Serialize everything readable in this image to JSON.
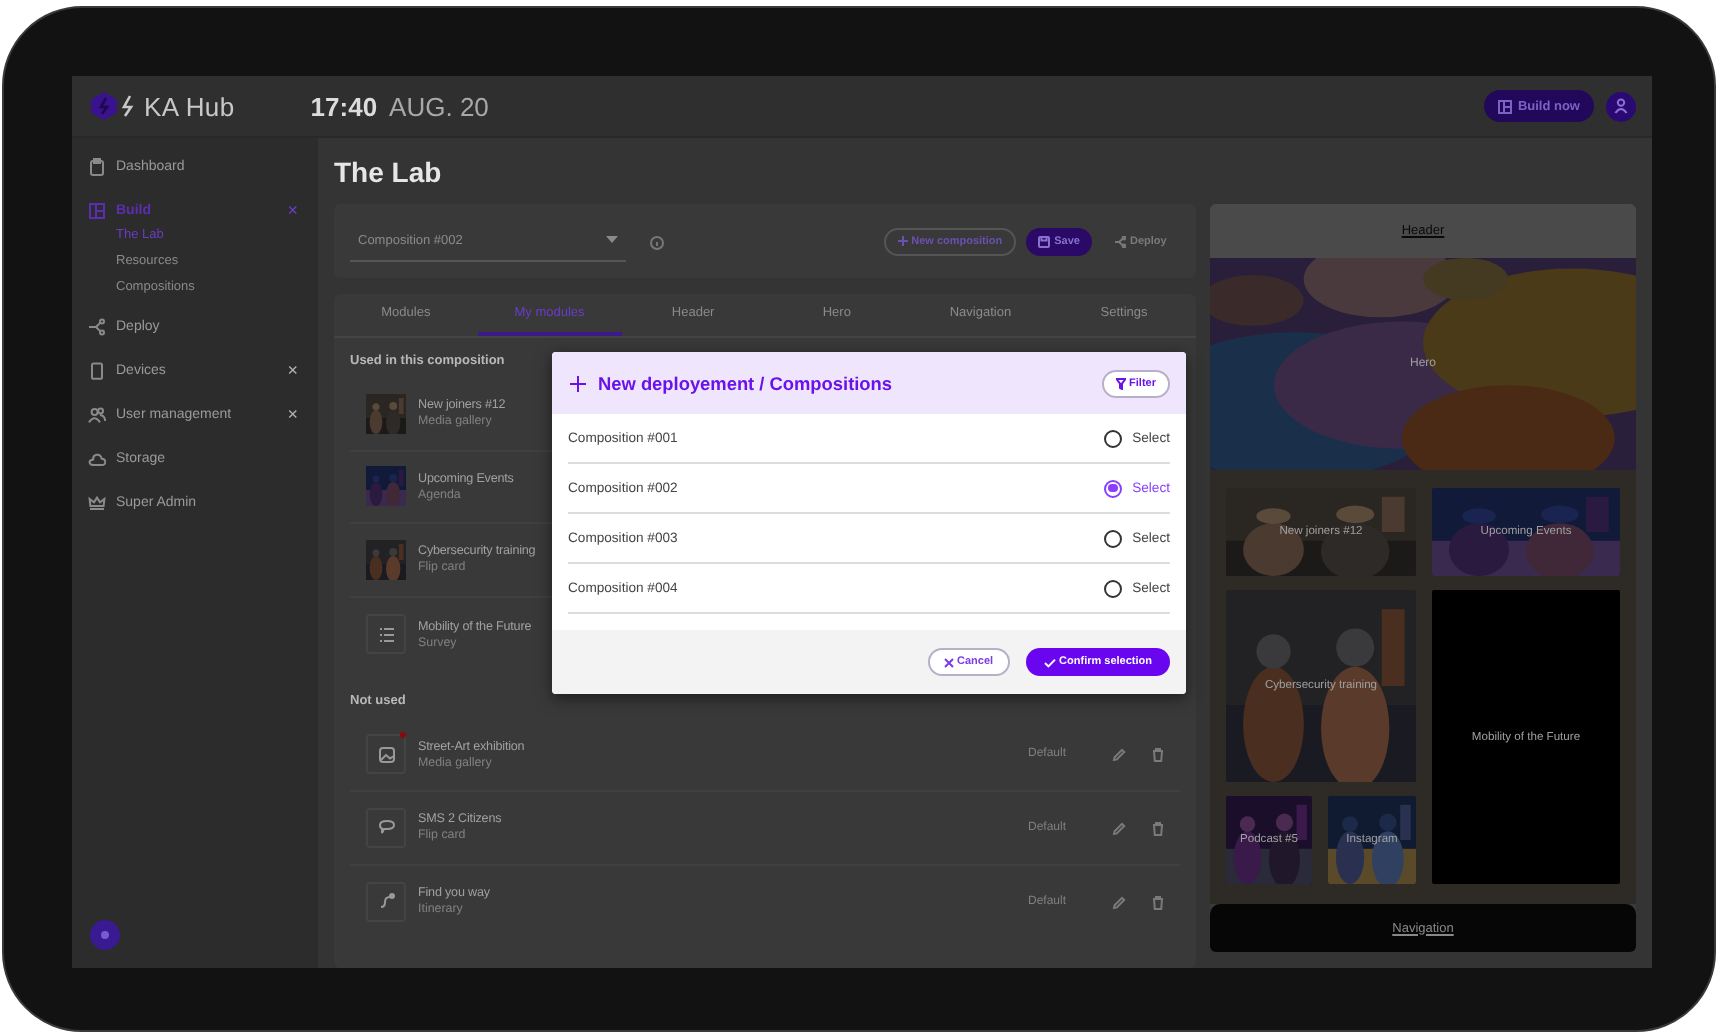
{
  "top_bar": {
    "logo": "KA Hub",
    "time": "17:40",
    "date": "AUG. 20",
    "build_button": "Build now"
  },
  "sidebar": {
    "items": [
      {
        "label": "Dashboard",
        "selected": false
      },
      {
        "label": "Build",
        "selected": true,
        "toggle": "×",
        "children": [
          {
            "label": "The Lab",
            "selected": true
          },
          {
            "label": "Resources",
            "selected": false
          },
          {
            "label": "Compositions",
            "selected": false
          }
        ]
      },
      {
        "label": "Deploy",
        "selected": false
      },
      {
        "label": "Devices",
        "selected": false,
        "toggle": "×"
      },
      {
        "label": "User management",
        "selected": false,
        "toggle": "×"
      },
      {
        "label": "Storage",
        "selected": false
      },
      {
        "label": "Super Admin",
        "selected": false
      }
    ]
  },
  "page": {
    "title": "The Lab",
    "composition_select": {
      "value": "Composition #002"
    },
    "new_composition": "New composition",
    "save": "Save",
    "deploy": {
      "label": "Deploy",
      "disabled": true
    }
  },
  "tabs": [
    {
      "label": "Modules",
      "selected": false
    },
    {
      "label": "My modules",
      "selected": true
    },
    {
      "label": "Header",
      "selected": false
    },
    {
      "label": "Hero",
      "selected": false
    },
    {
      "label": "Navigation",
      "selected": false
    },
    {
      "label": "Settings",
      "selected": false
    }
  ],
  "used_section": {
    "title": "Used in this composition",
    "modules": [
      {
        "name": "New joiners #12",
        "type": "Media gallery",
        "kind": "picture"
      },
      {
        "name": "Upcoming Events",
        "type": "Agenda",
        "kind": "picture"
      },
      {
        "name": "Cybersecurity training",
        "type": "Flip card",
        "kind": "picture"
      },
      {
        "name": "Mobility of the Future",
        "type": "Survey",
        "kind": "icon"
      }
    ]
  },
  "unused_section": {
    "title": "Not used",
    "modules": [
      {
        "name": "Street-Art exhibition",
        "type": "Media gallery",
        "kind": "icon",
        "badge": true,
        "status": "Default"
      },
      {
        "name": "SMS 2 Citizens",
        "type": "Flip card",
        "kind": "icon",
        "badge": false,
        "status": "Default"
      },
      {
        "name": "Find you way",
        "type": "Itinerary",
        "kind": "icon",
        "badge": false,
        "status": "Default"
      }
    ]
  },
  "preview": {
    "header": "Header",
    "hero": "Hero",
    "tiles": [
      {
        "label": "New joiners #12",
        "kind": "picture"
      },
      {
        "label": "Upcoming Events",
        "kind": "picture"
      },
      {
        "label": "Cybersecurity training",
        "kind": "picture"
      },
      {
        "label": "Mobility of the Future",
        "kind": "plain"
      },
      {
        "label": "Podcast #5",
        "kind": "picture"
      },
      {
        "label": "Instagram",
        "kind": "picture"
      }
    ],
    "navigation": "Navigation"
  },
  "modal": {
    "title": "New deployement / Compositions",
    "filter": "Filter",
    "options": [
      {
        "name": "Composition #001",
        "action": "Select",
        "selected": false
      },
      {
        "name": "Composition #002",
        "action": "Select",
        "selected": true
      },
      {
        "name": "Composition #003",
        "action": "Select",
        "selected": false
      },
      {
        "name": "Composition #004",
        "action": "Select",
        "selected": false
      }
    ],
    "cancel": "Cancel",
    "confirm": "Confirm selection"
  }
}
